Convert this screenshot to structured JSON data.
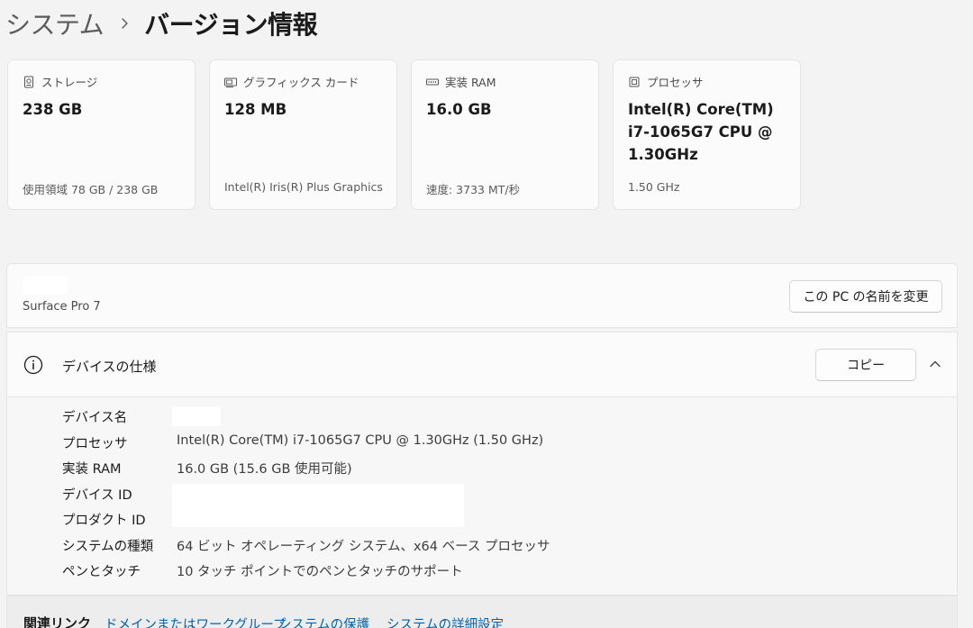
{
  "breadcrumb": {
    "parent": "システム",
    "separator_icon": "chevron-right-icon",
    "current": "バージョン情報"
  },
  "cards": [
    {
      "icon": "storage-icon",
      "title": "ストレージ",
      "value": "238 GB",
      "detail": "使用領域 78 GB / 238 GB"
    },
    {
      "icon": "graphics-card-icon",
      "title": "グラフィックス カード",
      "value": "128 MB",
      "detail": "Intel(R) Iris(R) Plus Graphics"
    },
    {
      "icon": "memory-icon",
      "title": "実装 RAM",
      "value": "16.0 GB",
      "detail": "速度: 3733 MT/秒"
    },
    {
      "icon": "processor-icon",
      "title": "プロセッサ",
      "value": "Intel(R) Core(TM) i7-1065G7 CPU @ 1.30GHz",
      "detail": "1.50 GHz"
    }
  ],
  "device": {
    "model": "Surface Pro 7",
    "rename_button": "この PC の名前を変更"
  },
  "specs": {
    "icon": "info-icon",
    "title": "デバイスの仕様",
    "copy_button": "コピー",
    "expanded": true,
    "rows": [
      {
        "label": "デバイス名",
        "value": ""
      },
      {
        "label": "プロセッサ",
        "value": "Intel(R) Core(TM) i7-1065G7 CPU @ 1.30GHz (1.50 GHz)"
      },
      {
        "label": "実装 RAM",
        "value": "16.0 GB (15.6 GB 使用可能)"
      },
      {
        "label": "デバイス ID",
        "value": ""
      },
      {
        "label": "プロダクト ID",
        "value": ""
      },
      {
        "label": "システムの種類",
        "value": "64 ビット オペレーティング システム、x64 ベース プロセッサ"
      },
      {
        "label": "ペンとタッチ",
        "value": "10 タッチ ポイントでのペンとタッチのサポート"
      }
    ]
  },
  "related": {
    "title": "関連リンク",
    "links": [
      "ドメインまたはワークグループ",
      "システムの保護",
      "システムの詳細設定"
    ]
  },
  "colors": {
    "background": "#f3f3f3",
    "card": "#fbfbfb",
    "link": "#0063b1",
    "text": "#1b1b1b"
  }
}
